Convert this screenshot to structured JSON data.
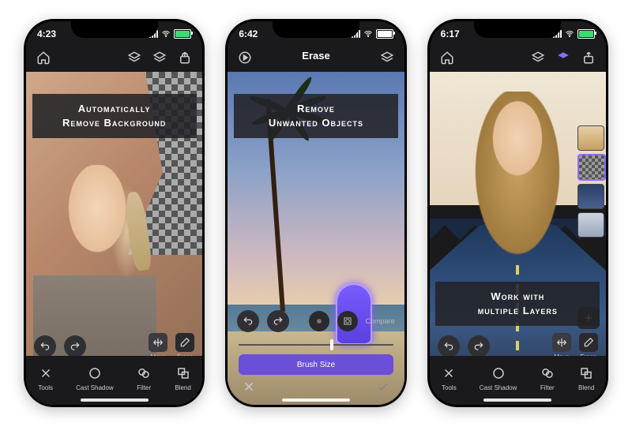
{
  "phone1": {
    "time": "4:23",
    "overlay": "Automatically\nRemove Background",
    "subtools": {
      "move": "Move",
      "erase": "Erase"
    },
    "bottom": [
      "Tools",
      "Cast Shadow",
      "Filter",
      "Blend"
    ]
  },
  "phone2": {
    "time": "6:42",
    "title": "Erase",
    "overlay": "Remove\nUnwanted Objects",
    "compare": "Compare",
    "brush": "Brush Size"
  },
  "phone3": {
    "time": "6:17",
    "overlay": "Work with\nmultiple Layers",
    "subtools": {
      "move": "Move",
      "erase": "Erase"
    },
    "bottom": [
      "Tools",
      "Cast Shadow",
      "Filter",
      "Blend"
    ]
  }
}
